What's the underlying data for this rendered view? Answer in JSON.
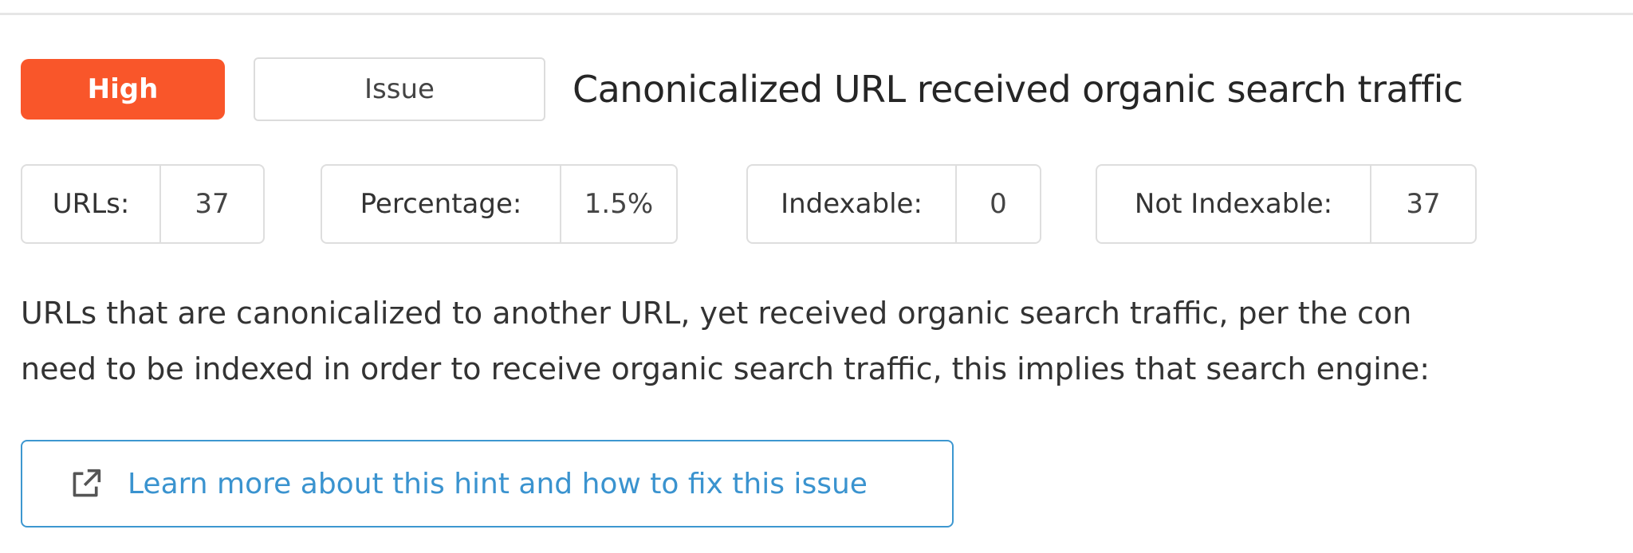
{
  "hint": {
    "priority": "High",
    "type": "Issue",
    "title": "Canonicalized URL received organic search traffic"
  },
  "stats": [
    {
      "label": "URLs:",
      "value": "37"
    },
    {
      "label": "Percentage:",
      "value": "1.5%"
    },
    {
      "label": "Indexable:",
      "value": "0"
    },
    {
      "label": "Not Indexable:",
      "value": "37"
    }
  ],
  "description": {
    "line1": "URLs that are canonicalized to another URL, yet received organic search traffic, per the con",
    "line2": "need to be indexed in order to receive organic search traffic, this implies that search engine:"
  },
  "learn_more": {
    "icon": "external-link-icon",
    "label": "Learn more about this hint and how to fix this issue"
  },
  "colors": {
    "priority_high": "#f9562a",
    "link": "#3a93cf"
  }
}
